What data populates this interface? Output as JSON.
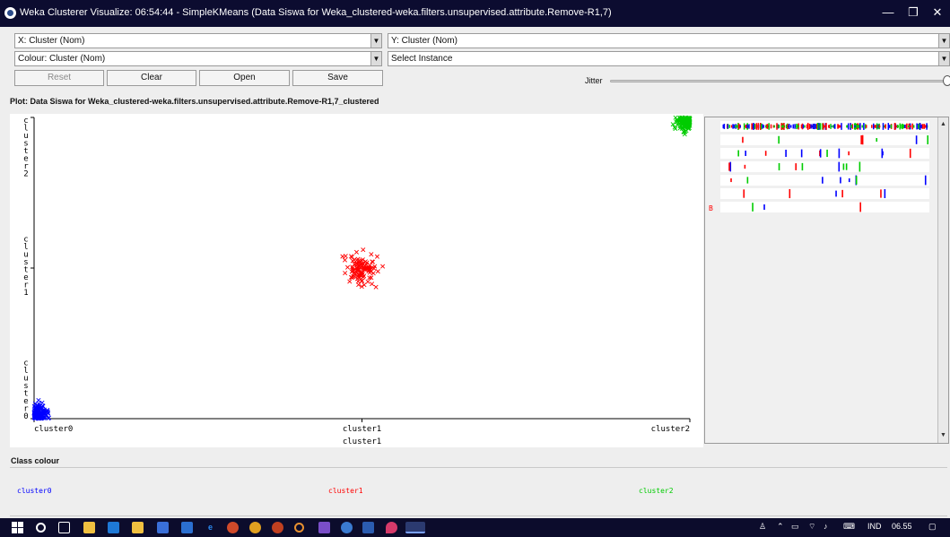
{
  "window": {
    "title": "Weka Clusterer Visualize: 06:54:44 - SimpleKMeans (Data Siswa for Weka_clustered-weka.filters.unsupervised.attribute.Remove-R1,7)",
    "minimize_glyph": "—",
    "maximize_glyph": "❐",
    "close_glyph": "✕"
  },
  "controls": {
    "x_select": "X: Cluster (Nom)",
    "y_select": "Y: Cluster (Nom)",
    "colour_select": "Colour: Cluster (Nom)",
    "instance_select": "Select Instance",
    "reset_label": "Reset",
    "clear_label": "Clear",
    "open_label": "Open",
    "save_label": "Save",
    "jitter_label": "Jitter",
    "jitter_level": 1.0
  },
  "plot": {
    "title": "Plot: Data Siswa for Weka_clustered-weka.filters.unsupervised.attribute.Remove-R1,7_clustered",
    "x_ticks": [
      "cluster0",
      "cluster1",
      "cluster2"
    ],
    "y_ticks": [
      "cluster0",
      "cluster1",
      "cluster2"
    ],
    "x_axis_label": "cluster1"
  },
  "chart_data": {
    "type": "scatter",
    "marker": "x",
    "categories": [
      "cluster0",
      "cluster1",
      "cluster2"
    ],
    "grid": false,
    "series": [
      {
        "name": "cluster0",
        "color": "#0000ff",
        "x": "cluster0",
        "y": "cluster0"
      },
      {
        "name": "cluster1",
        "color": "#ff0000",
        "x": "cluster1",
        "y": "cluster1"
      },
      {
        "name": "cluster2",
        "color": "#00cc00",
        "x": "cluster2",
        "y": "cluster2"
      }
    ]
  },
  "attribute_panel": {
    "class_marker": "B"
  },
  "class_colour": {
    "title": "Class colour",
    "items": [
      {
        "label": "cluster0",
        "color": "#0000ff"
      },
      {
        "label": "cluster1",
        "color": "#ff0000"
      },
      {
        "label": "cluster2",
        "color": "#00cc00"
      }
    ]
  },
  "taskbar": {
    "language": "IND",
    "time": "06.55"
  }
}
